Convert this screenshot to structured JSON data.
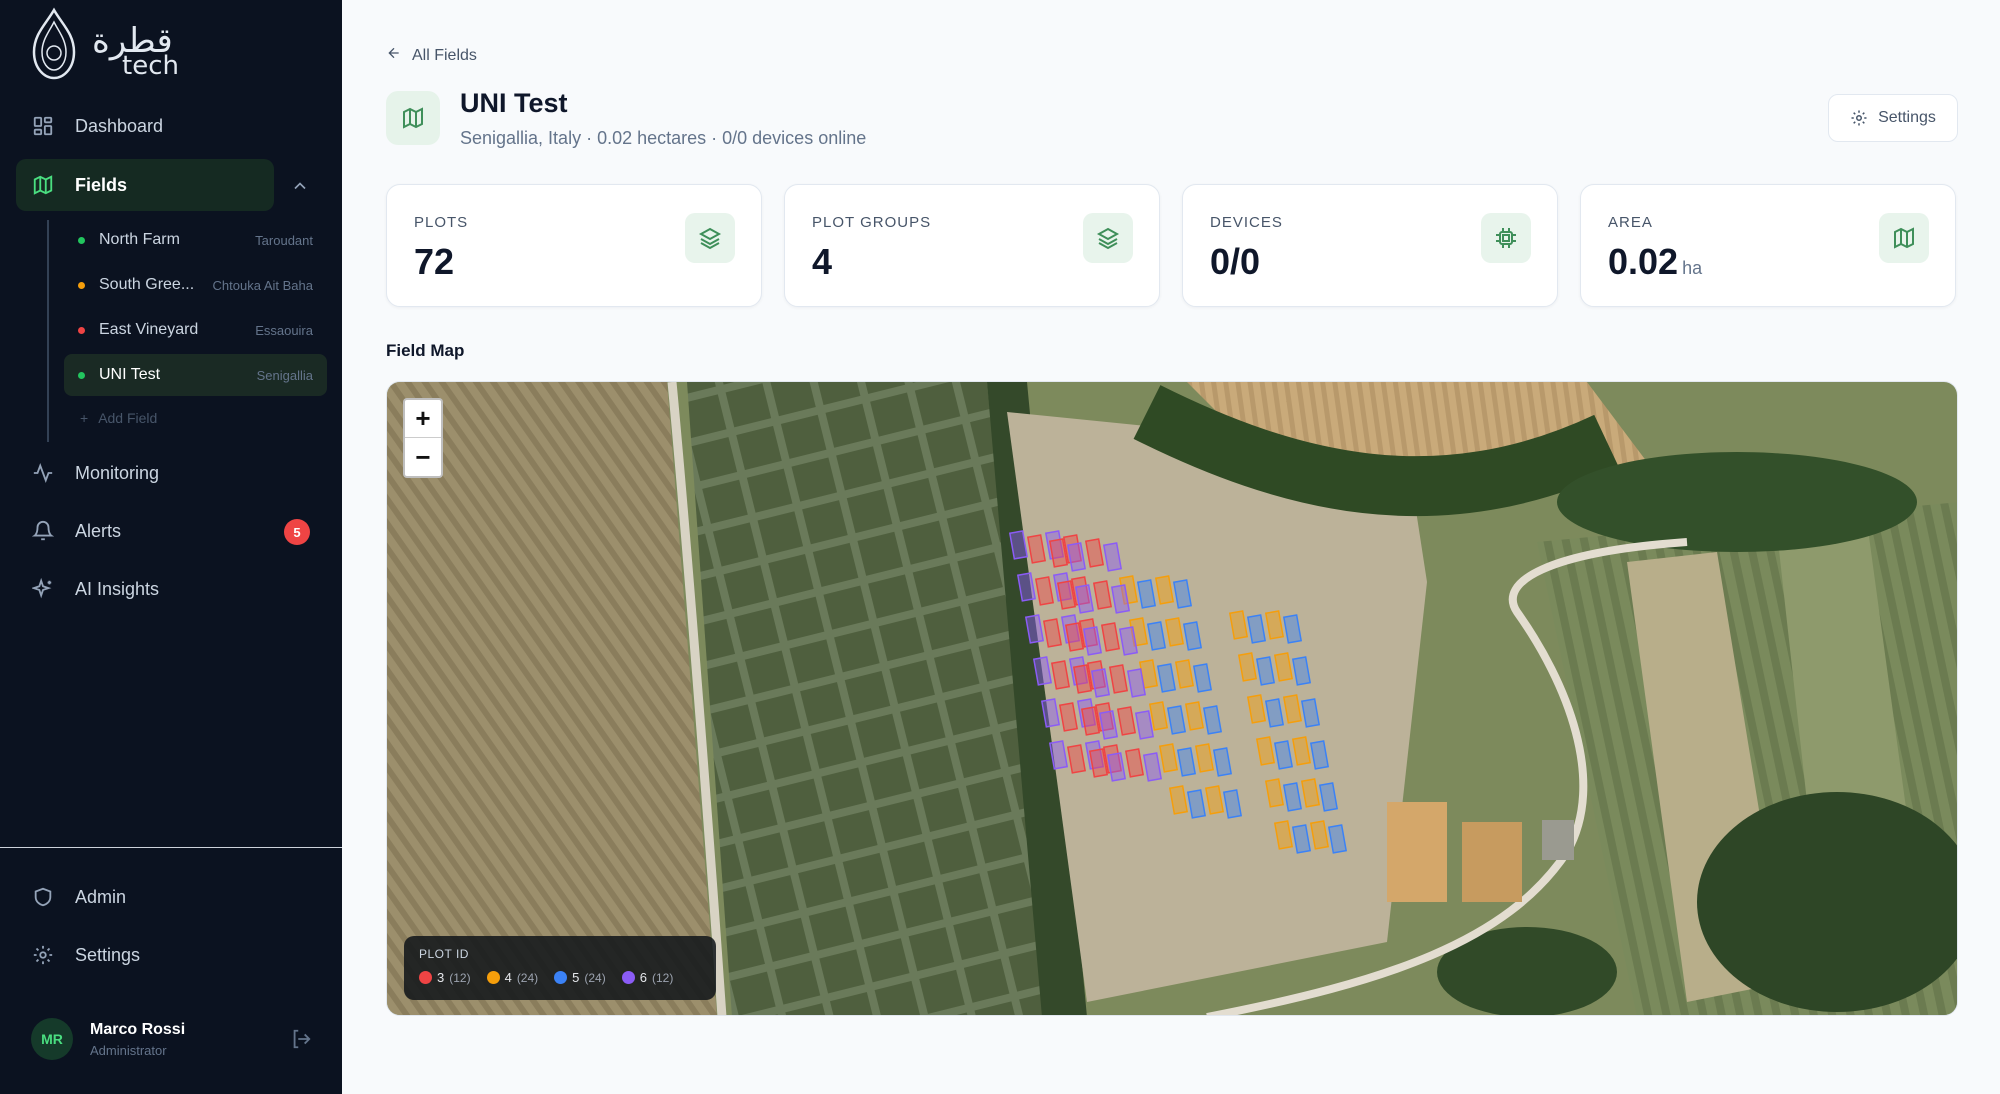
{
  "brand": {
    "logo_text": "قطرة",
    "logo_sub": "tech"
  },
  "sidebar": {
    "nav": [
      {
        "label": "Dashboard",
        "icon": "dashboard-icon"
      },
      {
        "label": "Fields",
        "icon": "map-icon",
        "active": true
      },
      {
        "label": "Monitoring",
        "icon": "activity-icon"
      },
      {
        "label": "Alerts",
        "icon": "bell-icon",
        "badge": "5"
      },
      {
        "label": "AI Insights",
        "icon": "sparkles-icon"
      }
    ],
    "fields": [
      {
        "name": "North Farm",
        "location": "Taroudant",
        "status_color": "#22c55e"
      },
      {
        "name": "South Gree...",
        "location": "Chtouka Ait Baha",
        "status_color": "#f59e0b"
      },
      {
        "name": "East Vineyard",
        "location": "Essaouira",
        "status_color": "#ef4444"
      },
      {
        "name": "UNI Test",
        "location": "Senigallia",
        "status_color": "#22c55e",
        "active": true
      }
    ],
    "add_field": "Add Field",
    "bottom": [
      {
        "label": "Admin",
        "icon": "shield-icon"
      },
      {
        "label": "Settings",
        "icon": "gear-icon"
      }
    ],
    "user": {
      "initials": "MR",
      "name": "Marco Rossi",
      "role": "Administrator"
    }
  },
  "header": {
    "back_label": "All Fields",
    "title": "UNI Test",
    "subtitle": "Senigallia, Italy · 0.02 hectares · 0/0 devices online",
    "settings_label": "Settings"
  },
  "stats": [
    {
      "label": "PLOTS",
      "value": "72",
      "unit": "",
      "icon": "layers-icon"
    },
    {
      "label": "PLOT GROUPS",
      "value": "4",
      "unit": "",
      "icon": "layers-icon"
    },
    {
      "label": "DEVICES",
      "value": "0/0",
      "unit": "",
      "icon": "chip-icon"
    },
    {
      "label": "AREA",
      "value": "0.02",
      "unit": "ha",
      "icon": "map-icon"
    }
  ],
  "map": {
    "section_title": "Field Map",
    "zoom_in": "+",
    "zoom_out": "−",
    "legend_title": "PLOT ID",
    "legend": [
      {
        "id": "3",
        "count": "(12)",
        "color": "#ef4444"
      },
      {
        "id": "4",
        "count": "(24)",
        "color": "#f59e0b"
      },
      {
        "id": "5",
        "count": "(24)",
        "color": "#3b82f6"
      },
      {
        "id": "6",
        "count": "(12)",
        "color": "#8b5cf6"
      }
    ]
  },
  "colors": {
    "accent": "#22c55e",
    "sidebar_bg": "#0b1220",
    "alert": "#ef4444"
  }
}
